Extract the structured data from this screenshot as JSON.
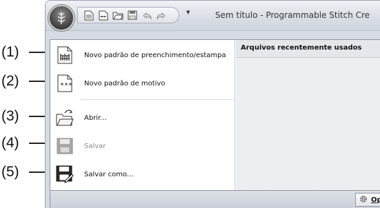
{
  "callouts": [
    "(1)",
    "(2)",
    "(3)",
    "(4)",
    "(5)"
  ],
  "window": {
    "title": "Sem título - Programmable Stitch Cre",
    "qat_icons": [
      "new-pattern-icon",
      "new-motif-icon",
      "open-folder-icon",
      "save-icon",
      "undo-icon",
      "redo-icon"
    ],
    "qat_dropdown": "▾"
  },
  "menu": {
    "commands": [
      {
        "label": "Novo padrão de preenchimento/estampa",
        "icon": "fill-pattern-icon",
        "enabled": true
      },
      {
        "label": "Novo padrão de motivo",
        "icon": "motif-pattern-icon",
        "enabled": true
      },
      {
        "label": "Abrir...",
        "icon": "open-folder-icon",
        "enabled": true
      },
      {
        "label": "Salvar",
        "icon": "save-icon",
        "enabled": false
      },
      {
        "label": "Salvar como...",
        "icon": "save-as-icon",
        "enabled": true
      }
    ],
    "recent_header": "Arquivos recentemente usados",
    "options_label": "Opç"
  },
  "colors": {
    "frame": "#d6dbe2",
    "menu_bg": "#ffffff",
    "recent_bg": "#eceef1",
    "disabled_text": "#8a8a8a"
  }
}
